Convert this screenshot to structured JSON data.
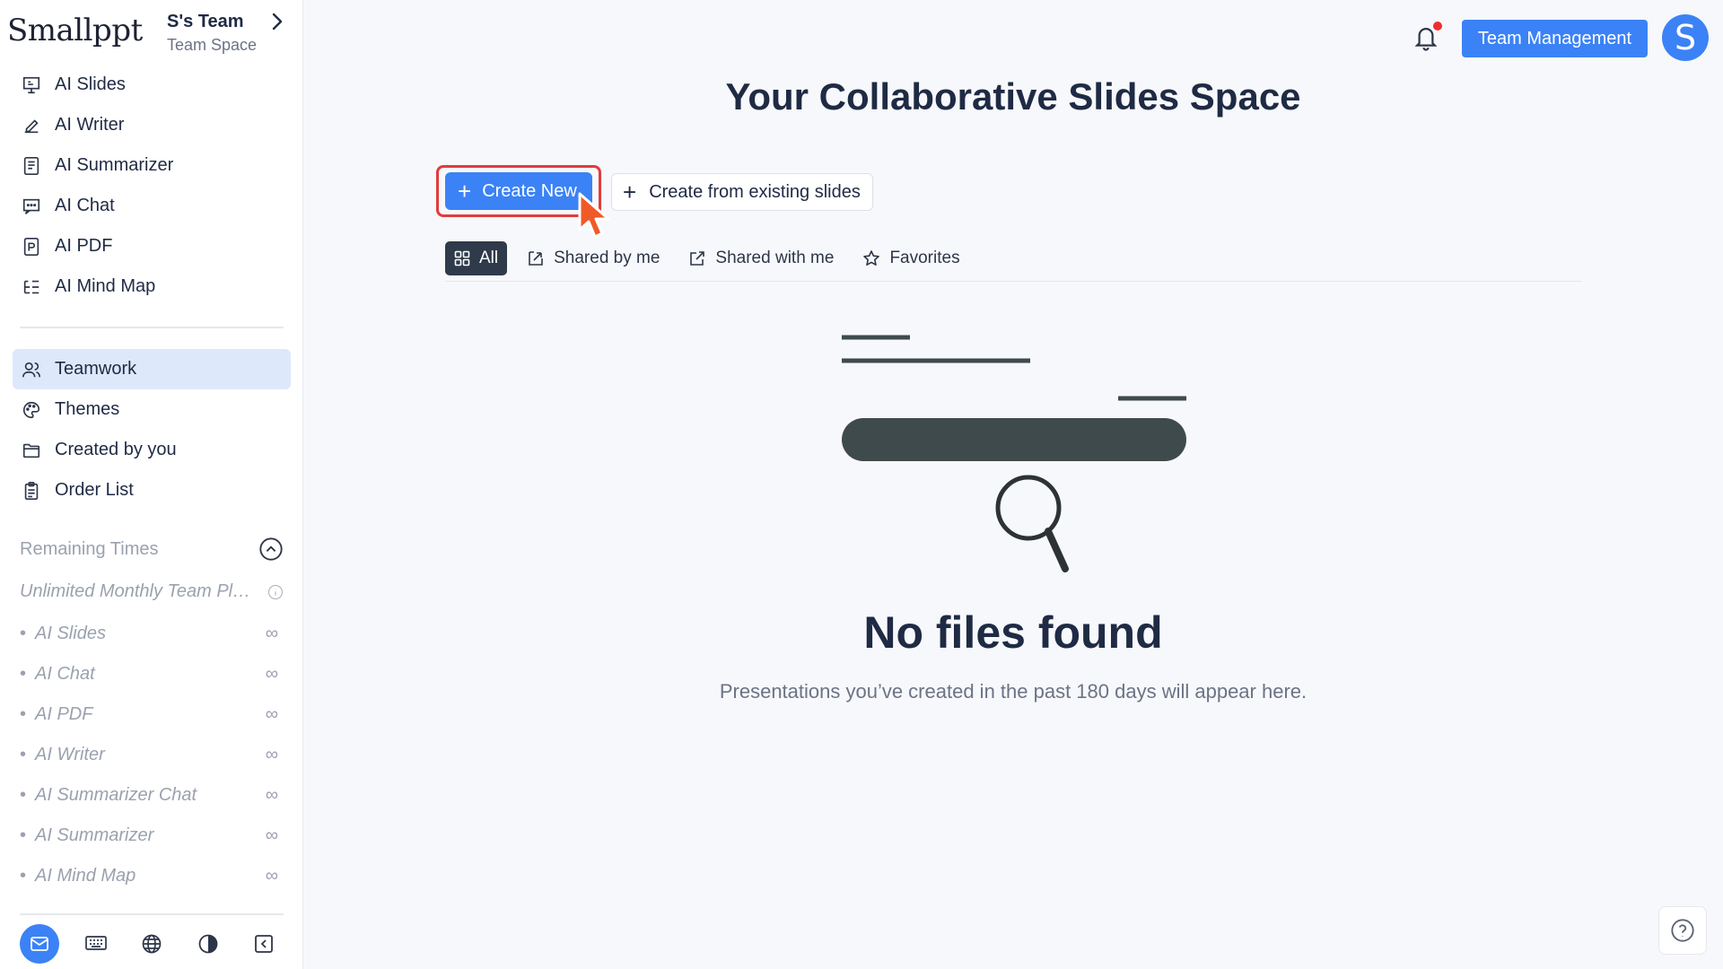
{
  "brand": {
    "name": "Smallppt"
  },
  "team": {
    "name": "S's Team",
    "subtitle": "Team Space"
  },
  "sidebar": {
    "tools": [
      {
        "label": "AI Slides",
        "icon": "presentation-icon"
      },
      {
        "label": "AI Writer",
        "icon": "pen-icon"
      },
      {
        "label": "AI Summarizer",
        "icon": "document-icon"
      },
      {
        "label": "AI Chat",
        "icon": "chat-icon"
      },
      {
        "label": "AI PDF",
        "icon": "pdf-icon"
      },
      {
        "label": "AI Mind Map",
        "icon": "mindmap-icon"
      }
    ],
    "sections": [
      {
        "label": "Teamwork",
        "icon": "users-icon",
        "active": true
      },
      {
        "label": "Themes",
        "icon": "palette-icon",
        "active": false
      },
      {
        "label": "Created by you",
        "icon": "folder-icon",
        "active": false
      },
      {
        "label": "Order List",
        "icon": "clipboard-icon",
        "active": false
      }
    ],
    "remaining": {
      "title": "Remaining Times",
      "plan": "Unlimited Monthly Team Pl…",
      "items": [
        {
          "label": "AI Slides",
          "value": "∞"
        },
        {
          "label": "AI Chat",
          "value": "∞"
        },
        {
          "label": "AI PDF",
          "value": "∞"
        },
        {
          "label": "AI Writer",
          "value": "∞"
        },
        {
          "label": "AI Summarizer Chat",
          "value": "∞"
        },
        {
          "label": "AI Summarizer",
          "value": "∞"
        },
        {
          "label": "AI Mind Map",
          "value": "∞"
        }
      ]
    },
    "bottom_icons": [
      "mail-icon",
      "keyboard-icon",
      "globe-icon",
      "contrast-icon",
      "collapse-icon"
    ]
  },
  "header": {
    "team_management_label": "Team Management",
    "avatar_letter": "S",
    "has_notification": true
  },
  "main": {
    "title": "Your Collaborative Slides Space",
    "create_new_label": "Create New",
    "create_existing_label": "Create from existing slides",
    "filters": [
      {
        "label": "All",
        "icon": "grid-icon",
        "active": true
      },
      {
        "label": "Shared by me",
        "icon": "share-out-icon",
        "active": false
      },
      {
        "label": "Shared with me",
        "icon": "external-link-icon",
        "active": false
      },
      {
        "label": "Favorites",
        "icon": "star-icon",
        "active": false
      }
    ],
    "empty_title": "No files found",
    "empty_subtitle": "Presentations you’ve created in the past 180 days will appear here."
  },
  "colors": {
    "accent": "#3b82f6",
    "highlight": "#e23b3b",
    "text": "#1f2a44",
    "active_nav_bg": "#dde8fb"
  }
}
